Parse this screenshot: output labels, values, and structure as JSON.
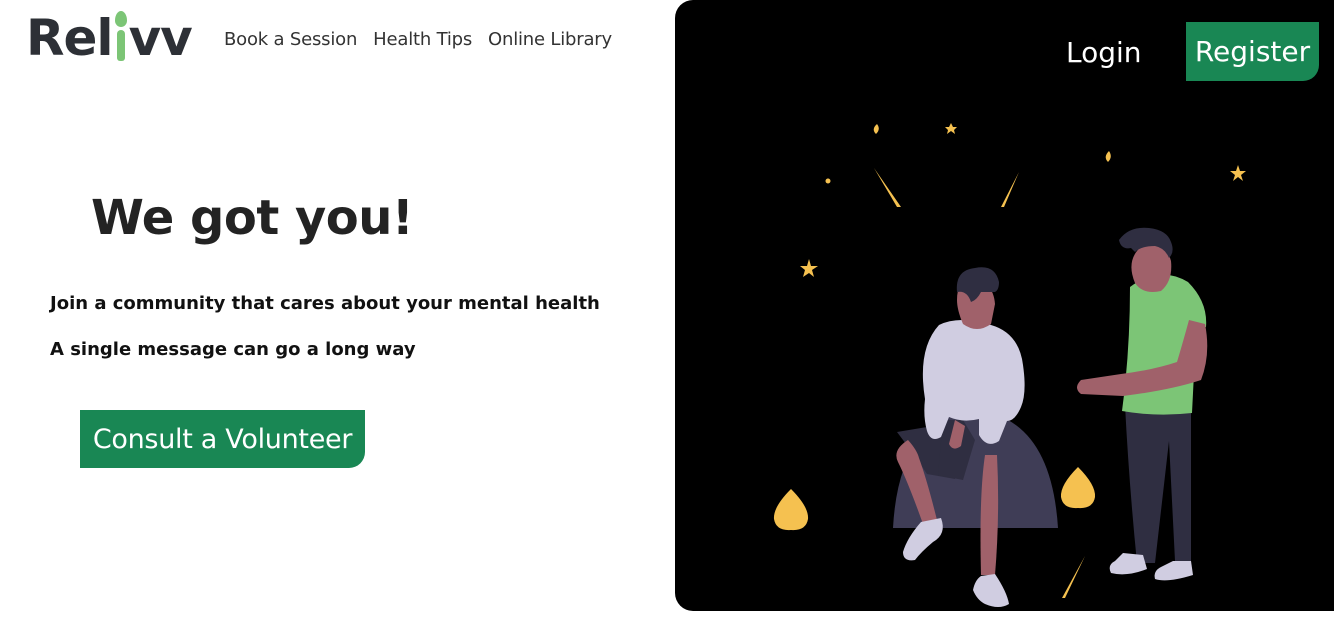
{
  "brand": {
    "name": "Relivv",
    "pre": "Rel",
    "post": "vv"
  },
  "nav": {
    "items": [
      "Book a Session",
      "Health Tips",
      "Online Library"
    ]
  },
  "auth": {
    "login": "Login",
    "register": "Register"
  },
  "hero": {
    "title": "We got you!",
    "line1": "Join a community that cares about your mental health",
    "line2": "A single message can go a long way",
    "cta": "Consult a Volunteer"
  },
  "colors": {
    "accent": "#198754",
    "brand_green": "#7cc576",
    "logo_dark": "#2d3036",
    "panel_bg": "#000000",
    "sparkle": "#f5c150"
  },
  "icons": {
    "illustration": "two-people-talking-illustration"
  }
}
